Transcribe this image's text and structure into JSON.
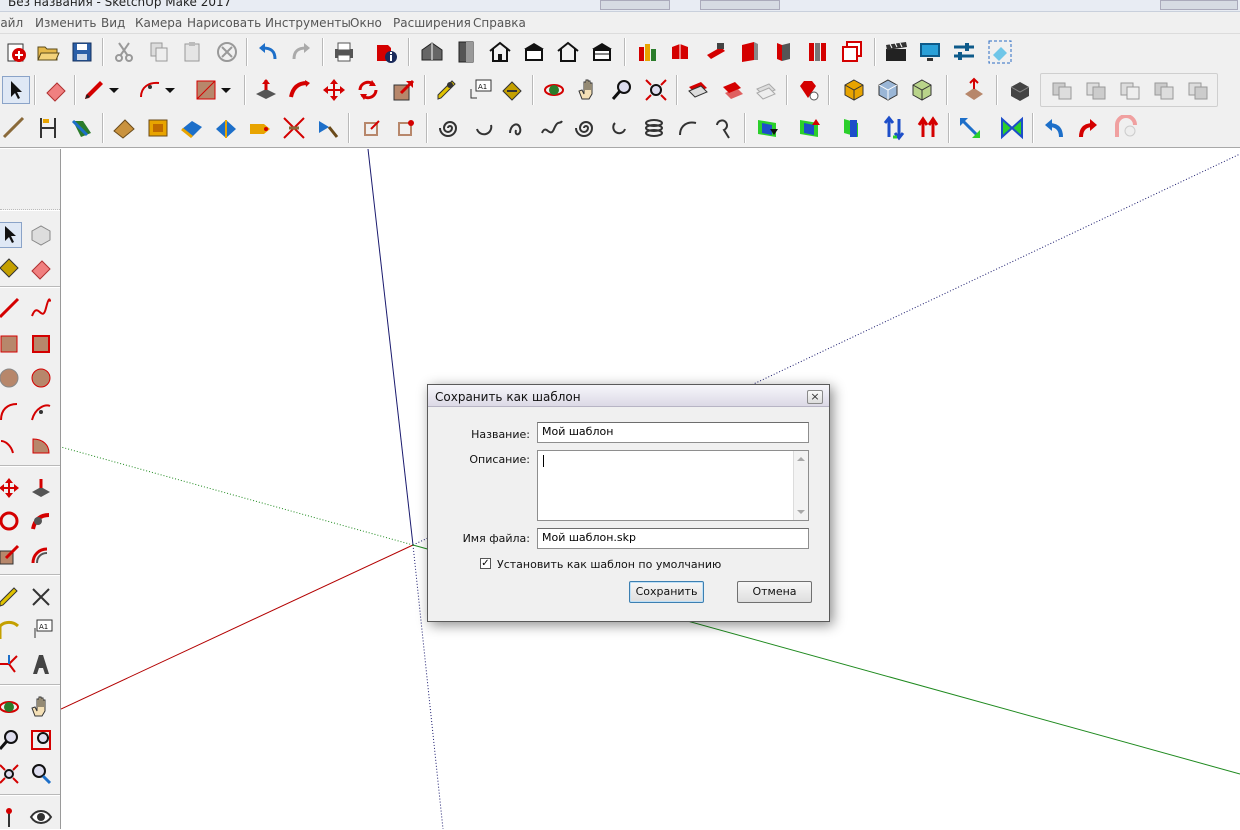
{
  "window": {
    "title": "Без названия - SketchUp Make 2017"
  },
  "menu": {
    "items": [
      "Файл",
      "Изменить",
      "Вид",
      "Камера",
      "Нарисовать",
      "Инструменты",
      "Окно",
      "Расширения",
      "Справка"
    ]
  },
  "dialog": {
    "title": "Сохранить как шаблон",
    "close": "×",
    "name_label": "Название:",
    "name_value": "Мой шаблон",
    "description_label": "Описание:",
    "description_value": "",
    "filename_label": "Имя файла:",
    "filename_value": "Мой шаблон.skp",
    "default_checkbox_label": "Установить как шаблон по умолчанию",
    "default_checkbox_checked": true,
    "checkmark": "✓",
    "save_label": "Сохранить",
    "cancel_label": "Отмена"
  },
  "colors": {
    "red_axis": "#b30000",
    "green_axis": "#1f8a1f",
    "blue_axis": "#1a1a6e",
    "accent_red": "#d40000",
    "accent_blue": "#1d6fc9"
  }
}
